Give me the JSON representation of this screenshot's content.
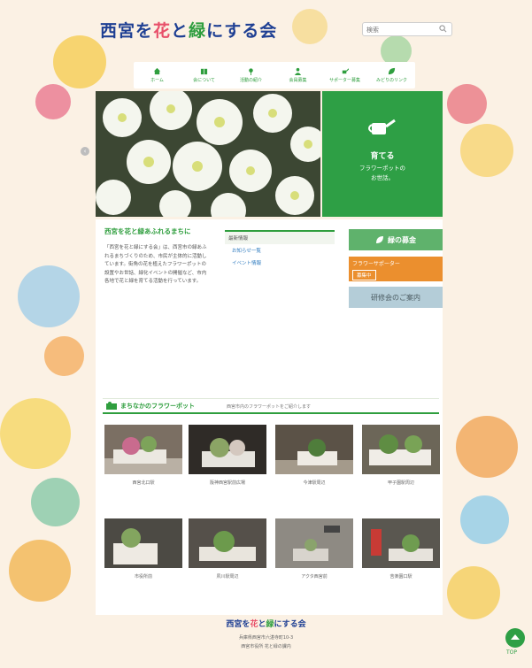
{
  "header": {
    "title_part1": "西宮を",
    "title_hana": "花",
    "title_part2": "と",
    "title_midori": "緑",
    "title_part3": "にする会",
    "search_placeholder": "検索"
  },
  "nav": [
    {
      "label": "ホーム",
      "icon": "home-icon"
    },
    {
      "label": "会について",
      "icon": "book-icon"
    },
    {
      "label": "活動の紹介",
      "icon": "flower-icon"
    },
    {
      "label": "会員募集",
      "icon": "people-icon"
    },
    {
      "label": "サポーター募集",
      "icon": "watering-can-icon"
    },
    {
      "label": "みどりのリンク",
      "icon": "leaf-icon"
    }
  ],
  "hero": {
    "headline": "育てる",
    "sub_line1": "フラワーポットの",
    "sub_line2": "お世話。"
  },
  "intro": {
    "title": "西宮を花と緑あふれるまちに",
    "body": "「西宮を花と緑にする会」は、西宮市の緑あふれるまちづくりのため、市民が主体的に活動しています。街角の花を植えたフラワーポットの設置やお世話、緑化イベントの開催など、市内各地で花と緑を育てる活動を行っています。"
  },
  "news": {
    "heading": "最新情報",
    "items": [
      "お知らせ一覧",
      "イベント情報"
    ]
  },
  "side": {
    "fund_label": "緑の募金",
    "supporter_line1": "フラワーサポーター",
    "supporter_line2": "募集中",
    "tour_label": "研修会のご案内"
  },
  "section": {
    "title": "まちなかのフラワーポット",
    "note": "西宮市内のフラワーポットをご紹介します"
  },
  "gallery": [
    {
      "caption": "西宮北口駅"
    },
    {
      "caption": "阪神西宮駅前広場"
    },
    {
      "caption": "今津駅周辺"
    },
    {
      "caption": "甲子園駅周辺"
    },
    {
      "caption": "市役所前"
    },
    {
      "caption": "夙川駅周辺"
    },
    {
      "caption": "アクタ西宮前"
    },
    {
      "caption": "苦楽園口駅"
    }
  ],
  "footer": {
    "title_part1": "西宮を",
    "title_hana": "花",
    "title_part2": "と",
    "title_midori": "緑",
    "title_part3": "にする会",
    "line1": "兵庫県西宮市六湛寺町10-3",
    "line2": "西宮市役所 花と緑の課内",
    "pagetop_label": "TOP"
  },
  "colors": {
    "brand_green": "#2e9f45",
    "brand_blue": "#1e3f93",
    "accent_pink": "#e8506a",
    "accent_orange": "#eb8f2e"
  }
}
